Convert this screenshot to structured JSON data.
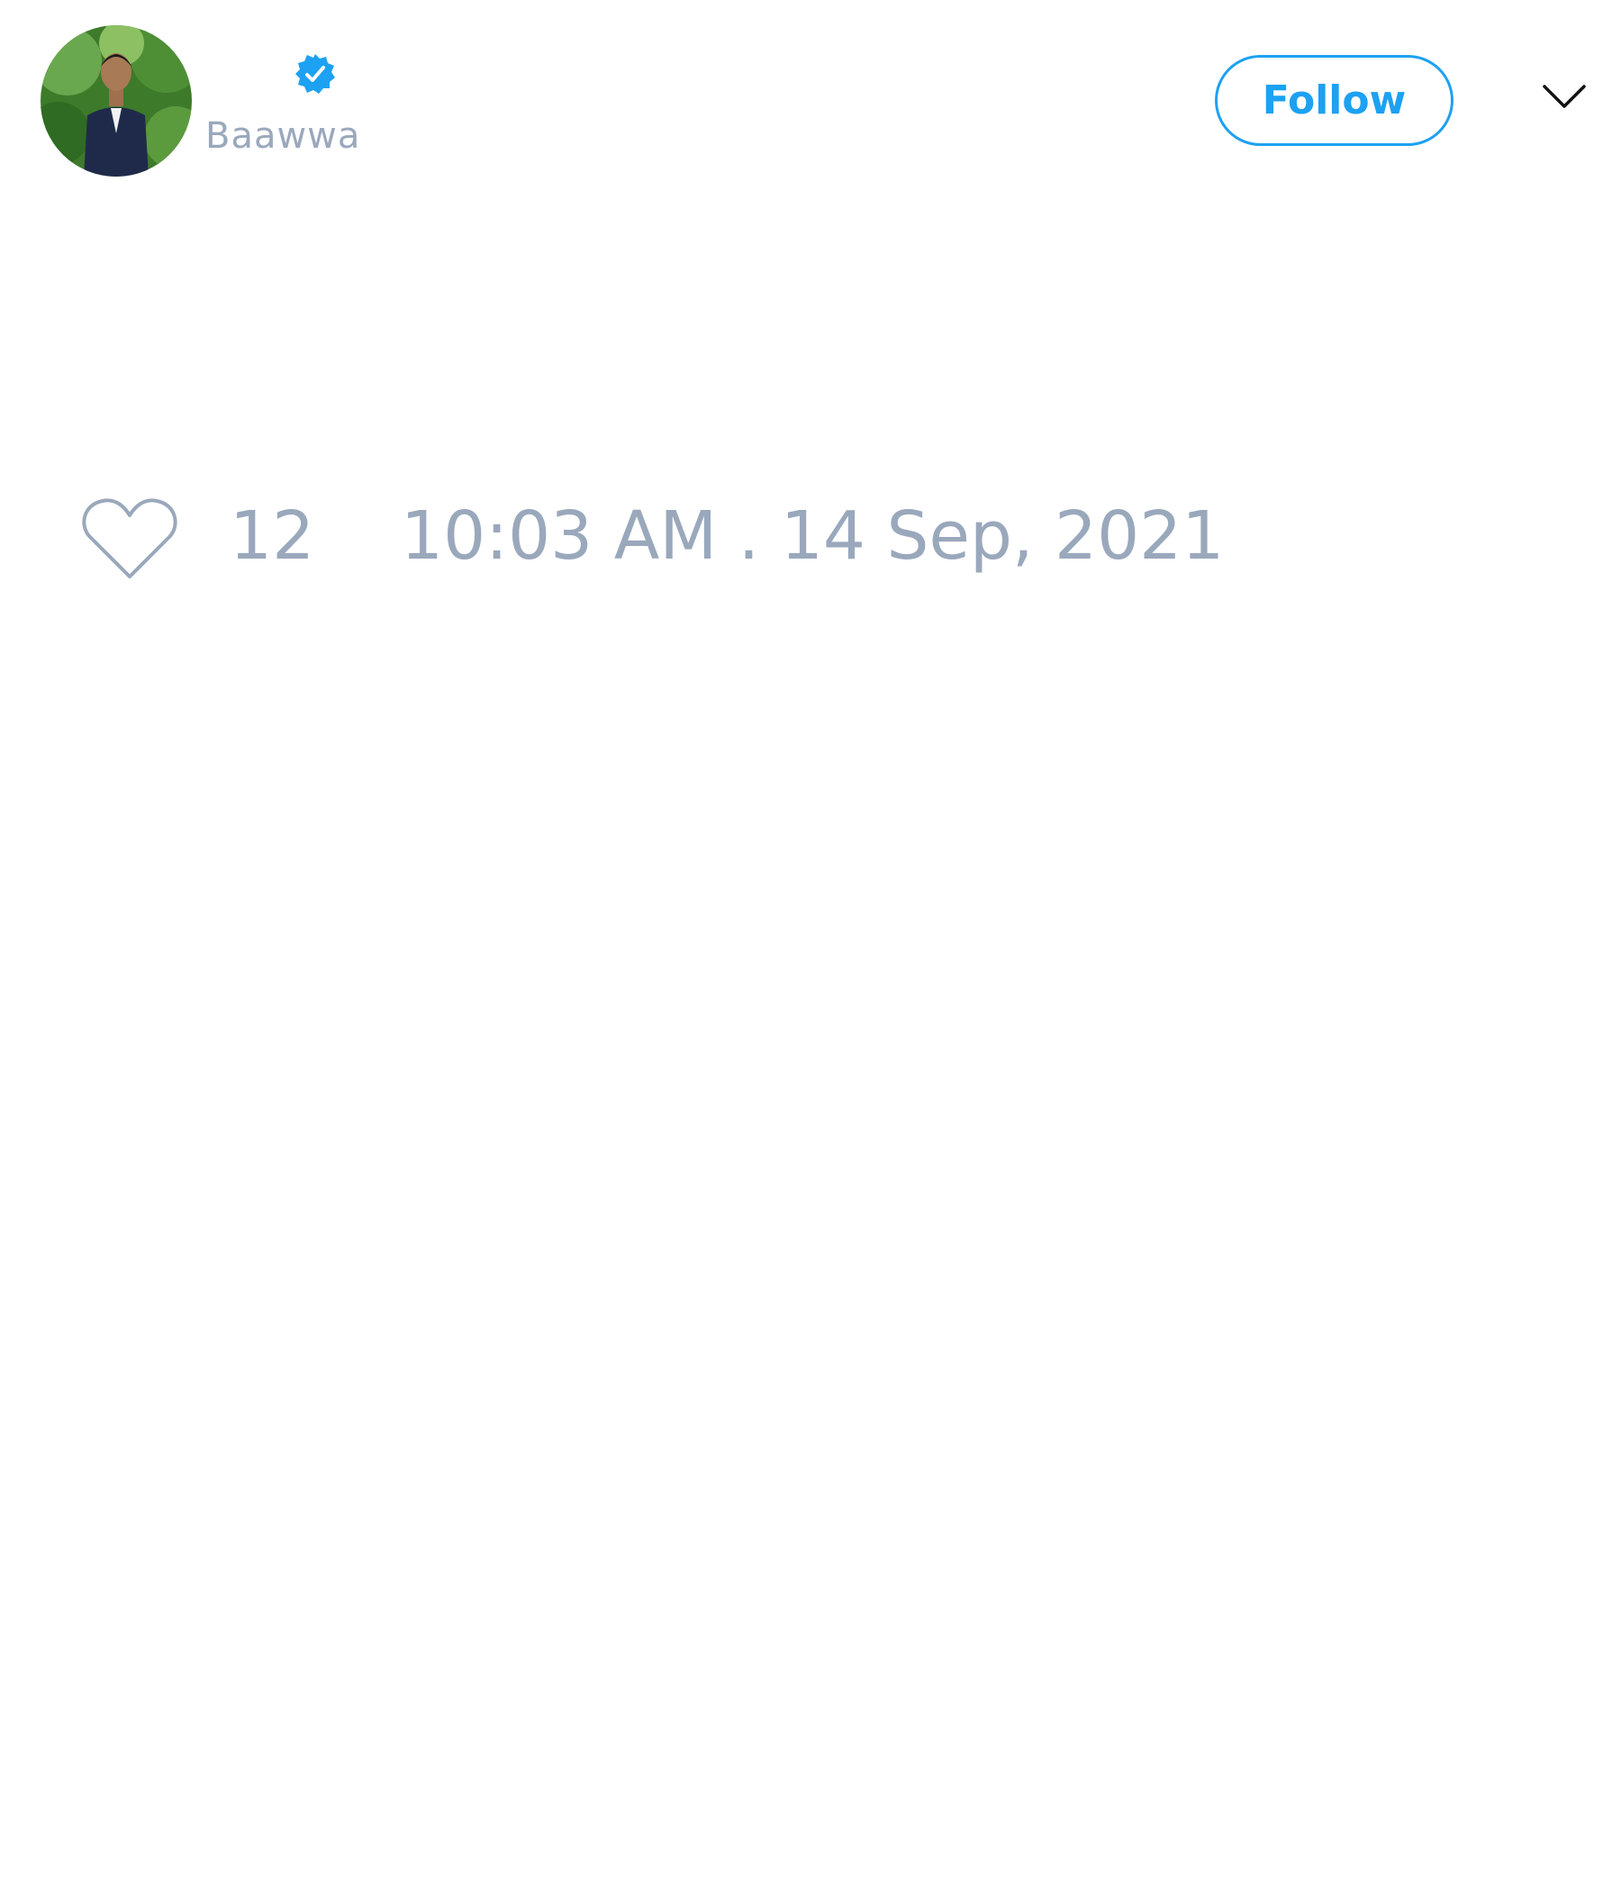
{
  "author": {
    "display_name": "",
    "username": "Baawwa",
    "verified": true,
    "avatar_icon": "avatar-photo"
  },
  "actions": {
    "follow_label": "Follow",
    "menu_icon": "chevron-down-icon"
  },
  "stats": {
    "likes_icon": "heart-icon",
    "likes": "12",
    "timestamp": "10:03 AM . 14 Sep, 2021"
  },
  "colors": {
    "accent": "#1da1f2",
    "muted_text": "#9aa8bc",
    "background": "#ffffff"
  }
}
